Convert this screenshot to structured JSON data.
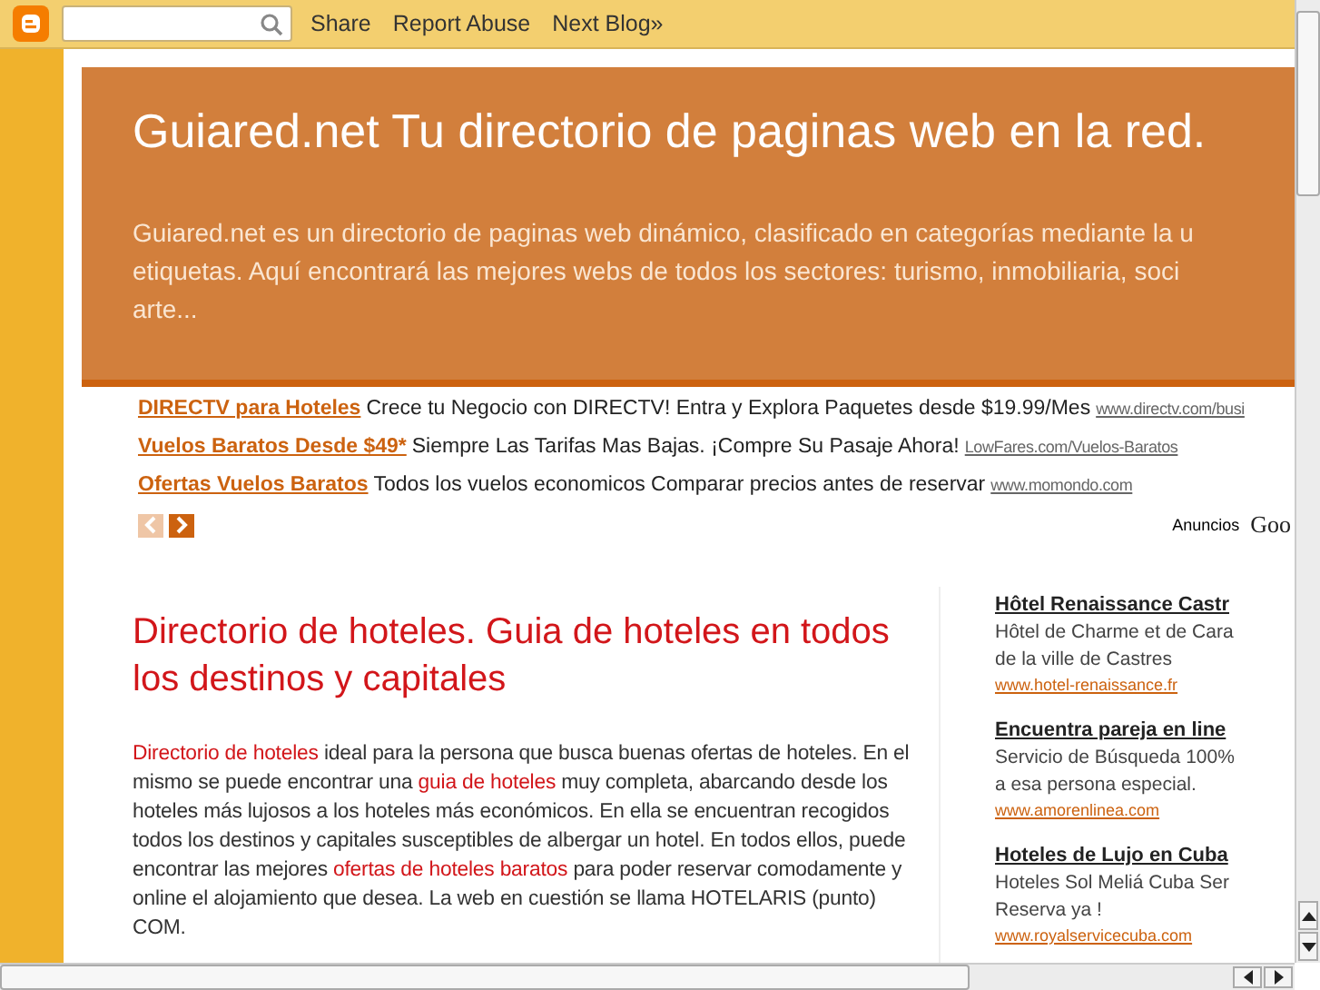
{
  "navbar": {
    "links": [
      "Share",
      "Report Abuse",
      "Next Blog»"
    ]
  },
  "header": {
    "title": "Guiared.net Tu directorio de paginas web en la red.",
    "description_lines": [
      "Guiared.net es un directorio de paginas web dinámico, clasificado en categorías mediante la u",
      "etiquetas. Aquí encontrará las mejores webs de todos los sectores: turismo, inmobiliaria, soci",
      "arte..."
    ]
  },
  "ads": {
    "items": [
      {
        "title": "DIRECTV para Hoteles",
        "text": "Crece tu Negocio con DIRECTV! Entra y Explora Paquetes desde $19.99/Mes",
        "url": "www.directv.com/busi"
      },
      {
        "title": "Vuelos Baratos Desde $49*",
        "text": "Siempre Las Tarifas Mas Bajas. ¡Compre Su Pasaje Ahora!",
        "url": "LowFares.com/Vuelos-Baratos"
      },
      {
        "title": "Ofertas Vuelos Baratos",
        "text": "Todos los vuelos economicos Comparar precios antes de reservar",
        "url": "www.momondo.com"
      }
    ],
    "prev": {
      "disabled": true
    },
    "next": {
      "disabled": false
    },
    "label": "Anuncios",
    "logo": "Goo"
  },
  "post": {
    "title": "Directorio de hoteles. Guia de hoteles en todos los destinos y capitales",
    "body": [
      {
        "text": "Directorio de hoteles",
        "link": true
      },
      {
        "text": " ideal para la persona que busca buenas ofertas de hoteles. En el mismo se puede encontrar una ",
        "link": false
      },
      {
        "text": "guia de hoteles",
        "link": true
      },
      {
        "text": " muy completa, abarcando desde los hoteles más lujosos a los hoteles más económicos.  En ella se encuentran recogidos todos los destinos y capitales susceptibles de albergar un hotel. En todos ellos, puede encontrar las mejores ",
        "link": false
      },
      {
        "text": "ofertas de hoteles baratos",
        "link": true
      },
      {
        "text": " para poder reservar comodamente y online el alojamiento que desea. La web en cuestión se llama HOTELARIS (punto) COM.",
        "link": false
      }
    ]
  },
  "sidebar_ads": [
    {
      "title": "Hôtel Renaissance Castr",
      "lines": [
        "Hôtel de Charme et de Cara",
        "de la ville de Castres"
      ],
      "url": "www.hotel-renaissance.fr"
    },
    {
      "title": "Encuentra pareja en line",
      "lines": [
        "Servicio de Búsqueda 100%",
        "a esa persona especial."
      ],
      "url": "www.amorenlinea.com"
    },
    {
      "title": "Hoteles de Lujo en Cuba",
      "lines": [
        "Hoteles Sol Meliá Cuba Ser",
        "Reserva ya !"
      ],
      "url": "www.royalservicecuba.com"
    }
  ]
}
